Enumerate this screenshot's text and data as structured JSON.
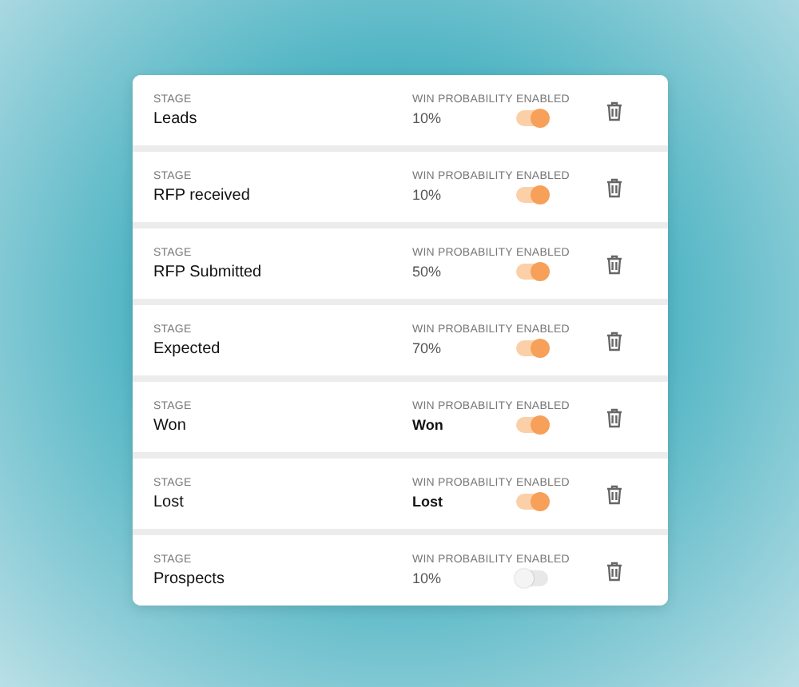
{
  "stages": [
    {
      "stage_label": "STAGE",
      "name": "Leads",
      "probability_label": "WIN PROBABILITY",
      "probability": "10%",
      "kind": "percent",
      "enabled_label": "ENABLED",
      "enabled": true
    },
    {
      "stage_label": "STAGE",
      "name": "RFP received",
      "probability_label": "WIN PROBABILITY",
      "probability": "10%",
      "kind": "percent",
      "enabled_label": "ENABLED",
      "enabled": true
    },
    {
      "stage_label": "STAGE",
      "name": "RFP Submitted",
      "probability_label": "WIN PROBABILITY",
      "probability": "50%",
      "kind": "percent",
      "enabled_label": "ENABLED",
      "enabled": true
    },
    {
      "stage_label": "STAGE",
      "name": "Expected",
      "probability_label": "WIN PROBABILITY",
      "probability": "70%",
      "kind": "percent",
      "enabled_label": "ENABLED",
      "enabled": true
    },
    {
      "stage_label": "STAGE",
      "name": "Won",
      "probability_label": "WIN PROBABILITY",
      "probability": "Won",
      "kind": "outcome",
      "enabled_label": "ENABLED",
      "enabled": true
    },
    {
      "stage_label": "STAGE",
      "name": "Lost",
      "probability_label": "WIN PROBABILITY",
      "probability": "Lost",
      "kind": "outcome",
      "enabled_label": "ENABLED",
      "enabled": true
    },
    {
      "stage_label": "STAGE",
      "name": "Prospects",
      "probability_label": "WIN PROBABILITY",
      "probability": "10%",
      "kind": "percent",
      "enabled_label": "ENABLED",
      "enabled": false
    }
  ]
}
